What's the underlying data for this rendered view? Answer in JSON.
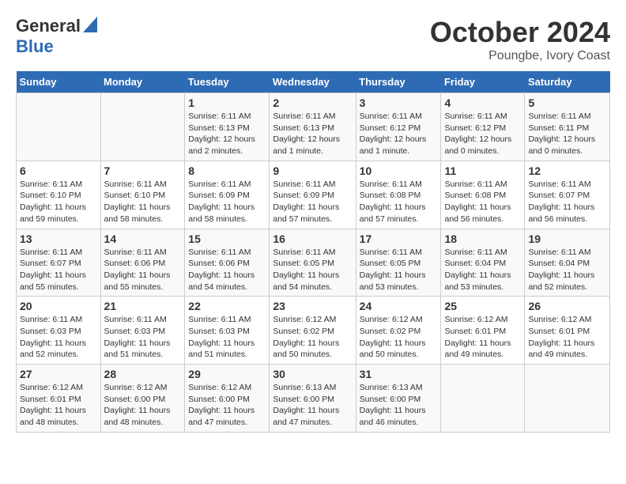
{
  "logo": {
    "general": "General",
    "blue": "Blue"
  },
  "title": "October 2024",
  "subtitle": "Poungbe, Ivory Coast",
  "days_of_week": [
    "Sunday",
    "Monday",
    "Tuesday",
    "Wednesday",
    "Thursday",
    "Friday",
    "Saturday"
  ],
  "weeks": [
    [
      {
        "day": "",
        "info": ""
      },
      {
        "day": "",
        "info": ""
      },
      {
        "day": "1",
        "info": "Sunrise: 6:11 AM\nSunset: 6:13 PM\nDaylight: 12 hours and 2 minutes."
      },
      {
        "day": "2",
        "info": "Sunrise: 6:11 AM\nSunset: 6:13 PM\nDaylight: 12 hours and 1 minute."
      },
      {
        "day": "3",
        "info": "Sunrise: 6:11 AM\nSunset: 6:12 PM\nDaylight: 12 hours and 1 minute."
      },
      {
        "day": "4",
        "info": "Sunrise: 6:11 AM\nSunset: 6:12 PM\nDaylight: 12 hours and 0 minutes."
      },
      {
        "day": "5",
        "info": "Sunrise: 6:11 AM\nSunset: 6:11 PM\nDaylight: 12 hours and 0 minutes."
      }
    ],
    [
      {
        "day": "6",
        "info": "Sunrise: 6:11 AM\nSunset: 6:10 PM\nDaylight: 11 hours and 59 minutes."
      },
      {
        "day": "7",
        "info": "Sunrise: 6:11 AM\nSunset: 6:10 PM\nDaylight: 11 hours and 58 minutes."
      },
      {
        "day": "8",
        "info": "Sunrise: 6:11 AM\nSunset: 6:09 PM\nDaylight: 11 hours and 58 minutes."
      },
      {
        "day": "9",
        "info": "Sunrise: 6:11 AM\nSunset: 6:09 PM\nDaylight: 11 hours and 57 minutes."
      },
      {
        "day": "10",
        "info": "Sunrise: 6:11 AM\nSunset: 6:08 PM\nDaylight: 11 hours and 57 minutes."
      },
      {
        "day": "11",
        "info": "Sunrise: 6:11 AM\nSunset: 6:08 PM\nDaylight: 11 hours and 56 minutes."
      },
      {
        "day": "12",
        "info": "Sunrise: 6:11 AM\nSunset: 6:07 PM\nDaylight: 11 hours and 56 minutes."
      }
    ],
    [
      {
        "day": "13",
        "info": "Sunrise: 6:11 AM\nSunset: 6:07 PM\nDaylight: 11 hours and 55 minutes."
      },
      {
        "day": "14",
        "info": "Sunrise: 6:11 AM\nSunset: 6:06 PM\nDaylight: 11 hours and 55 minutes."
      },
      {
        "day": "15",
        "info": "Sunrise: 6:11 AM\nSunset: 6:06 PM\nDaylight: 11 hours and 54 minutes."
      },
      {
        "day": "16",
        "info": "Sunrise: 6:11 AM\nSunset: 6:05 PM\nDaylight: 11 hours and 54 minutes."
      },
      {
        "day": "17",
        "info": "Sunrise: 6:11 AM\nSunset: 6:05 PM\nDaylight: 11 hours and 53 minutes."
      },
      {
        "day": "18",
        "info": "Sunrise: 6:11 AM\nSunset: 6:04 PM\nDaylight: 11 hours and 53 minutes."
      },
      {
        "day": "19",
        "info": "Sunrise: 6:11 AM\nSunset: 6:04 PM\nDaylight: 11 hours and 52 minutes."
      }
    ],
    [
      {
        "day": "20",
        "info": "Sunrise: 6:11 AM\nSunset: 6:03 PM\nDaylight: 11 hours and 52 minutes."
      },
      {
        "day": "21",
        "info": "Sunrise: 6:11 AM\nSunset: 6:03 PM\nDaylight: 11 hours and 51 minutes."
      },
      {
        "day": "22",
        "info": "Sunrise: 6:11 AM\nSunset: 6:03 PM\nDaylight: 11 hours and 51 minutes."
      },
      {
        "day": "23",
        "info": "Sunrise: 6:12 AM\nSunset: 6:02 PM\nDaylight: 11 hours and 50 minutes."
      },
      {
        "day": "24",
        "info": "Sunrise: 6:12 AM\nSunset: 6:02 PM\nDaylight: 11 hours and 50 minutes."
      },
      {
        "day": "25",
        "info": "Sunrise: 6:12 AM\nSunset: 6:01 PM\nDaylight: 11 hours and 49 minutes."
      },
      {
        "day": "26",
        "info": "Sunrise: 6:12 AM\nSunset: 6:01 PM\nDaylight: 11 hours and 49 minutes."
      }
    ],
    [
      {
        "day": "27",
        "info": "Sunrise: 6:12 AM\nSunset: 6:01 PM\nDaylight: 11 hours and 48 minutes."
      },
      {
        "day": "28",
        "info": "Sunrise: 6:12 AM\nSunset: 6:00 PM\nDaylight: 11 hours and 48 minutes."
      },
      {
        "day": "29",
        "info": "Sunrise: 6:12 AM\nSunset: 6:00 PM\nDaylight: 11 hours and 47 minutes."
      },
      {
        "day": "30",
        "info": "Sunrise: 6:13 AM\nSunset: 6:00 PM\nDaylight: 11 hours and 47 minutes."
      },
      {
        "day": "31",
        "info": "Sunrise: 6:13 AM\nSunset: 6:00 PM\nDaylight: 11 hours and 46 minutes."
      },
      {
        "day": "",
        "info": ""
      },
      {
        "day": "",
        "info": ""
      }
    ]
  ]
}
